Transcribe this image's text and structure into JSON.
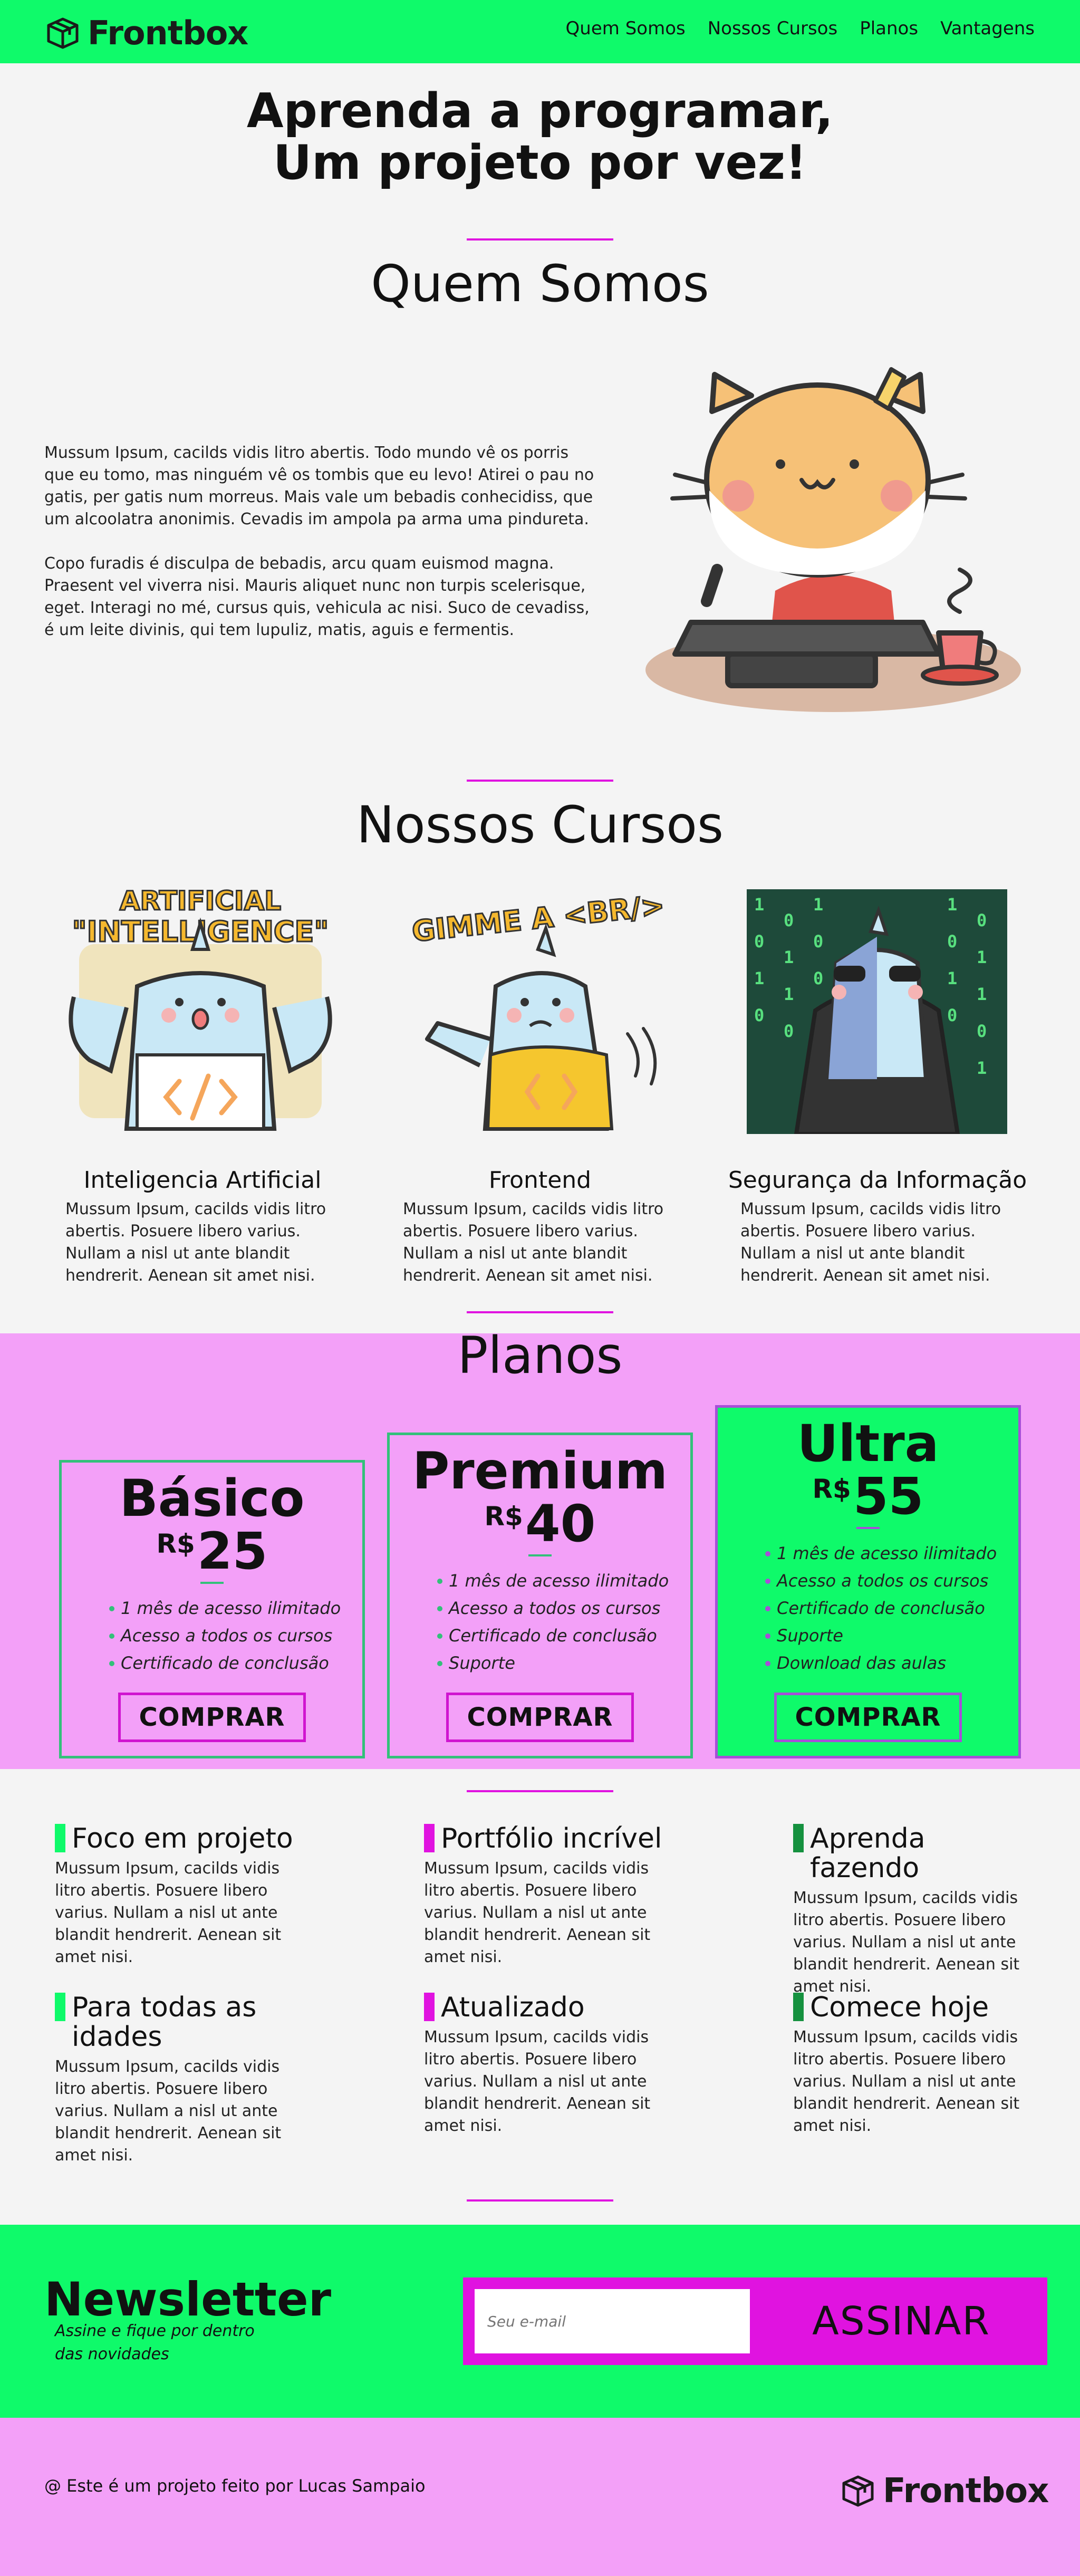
{
  "header": {
    "logo_text": "Frontbox",
    "nav": [
      "Quem Somos",
      "Nossos Cursos",
      "Planos",
      "Vantagens"
    ]
  },
  "hero": {
    "line1": "Aprenda a programar,",
    "line2": "Um projeto por vez!"
  },
  "about": {
    "title": "Quem Somos",
    "p1": "Mussum Ipsum, cacilds vidis litro abertis. Todo mundo vê os porris que eu tomo, mas ninguém vê os tombis que eu levo! Atirei o pau no gatis, per gatis num morreus. Mais vale um bebadis conhecidiss, que um alcoolatra anonimis. Cevadis im ampola pa arma uma pindureta.",
    "p2": "Copo furadis é disculpa de bebadis, arcu quam euismod magna. Praesent vel viverra nisi. Mauris aliquet nunc non turpis scelerisque, eget. Interagi no mé, cursus quis, vehicula ac nisi. Suco de cevadiss, é um leite divinis, qui tem lupuliz, matis, aguis e fermentis."
  },
  "courses": {
    "title": "Nossos Cursos",
    "items": [
      {
        "title": "Inteligencia Artificial",
        "sign": "ARTIFICIAL \"INTELLIGENCE\"",
        "desc": "Mussum Ipsum, cacilds vidis litro abertis. Posuere libero varius. Nullam a nisl ut ante blandit hendrerit. Aenean sit amet nisi."
      },
      {
        "title": "Frontend",
        "sign": "GIMME A <BR/>",
        "desc": "Mussum Ipsum, cacilds vidis litro abertis. Posuere libero varius. Nullam a nisl ut ante blandit hendrerit. Aenean sit amet nisi."
      },
      {
        "title": "Segurança da Informação",
        "desc": "Mussum Ipsum, cacilds vidis litro abertis. Posuere libero varius. Nullam a nisl ut ante blandit hendrerit. Aenean sit amet nisi."
      }
    ]
  },
  "plans": {
    "title": "Planos",
    "buy_label": "COMPRAR",
    "currency": "R$",
    "items": [
      {
        "name": "Básico",
        "price": "25",
        "features": [
          "1 mês de acesso ilimitado",
          "Acesso a todos os cursos",
          "Certificado de conclusão"
        ]
      },
      {
        "name": "Premium",
        "price": "40",
        "features": [
          "1 mês de acesso ilimitado",
          "Acesso a todos os cursos",
          "Certificado de conclusão",
          "Suporte"
        ]
      },
      {
        "name": "Ultra",
        "price": "55",
        "features": [
          "1 mês de acesso ilimitado",
          "Acesso a todos os cursos",
          "Certificado de conclusão",
          "Suporte",
          "Download das aulas"
        ]
      }
    ]
  },
  "features": {
    "items": [
      {
        "title": "Foco em projeto",
        "desc": "Mussum Ipsum, cacilds vidis litro abertis. Posuere libero varius. Nullam a nisl ut ante blandit hendrerit. Aenean sit amet nisi."
      },
      {
        "title": "Portfólio incrível",
        "desc": "Mussum Ipsum, cacilds vidis litro abertis. Posuere libero varius. Nullam a nisl ut ante blandit hendrerit. Aenean sit amet nisi."
      },
      {
        "title": "Aprenda fazendo",
        "desc": "Mussum Ipsum, cacilds vidis litro abertis. Posuere libero varius. Nullam a nisl ut ante blandit hendrerit. Aenean sit amet nisi."
      },
      {
        "title": "Para todas as idades",
        "desc": "Mussum Ipsum, cacilds vidis litro abertis. Posuere libero varius. Nullam a nisl ut ante blandit hendrerit. Aenean sit amet nisi."
      },
      {
        "title": "Atualizado",
        "desc": "Mussum Ipsum, cacilds vidis litro abertis. Posuere libero varius. Nullam a nisl ut ante blandit hendrerit. Aenean sit amet nisi."
      },
      {
        "title": "Comece hoje",
        "desc": "Mussum Ipsum, cacilds vidis litro abertis. Posuere libero varius. Nullam a nisl ut ante blandit hendrerit. Aenean sit amet nisi."
      }
    ]
  },
  "newsletter": {
    "title": "Newsletter",
    "subtitle": "Assine e fique por dentro das novidades",
    "placeholder": "Seu e-mail",
    "button": "ASSINAR"
  },
  "footer": {
    "credit": "@ Este é um projeto feito por Lucas Sampaio",
    "logo_text": "Frontbox"
  },
  "colors": {
    "green": "#0ffa6a",
    "magenta": "#e013e0",
    "pink": "#f3a0f8",
    "dark_green": "#15913f"
  }
}
